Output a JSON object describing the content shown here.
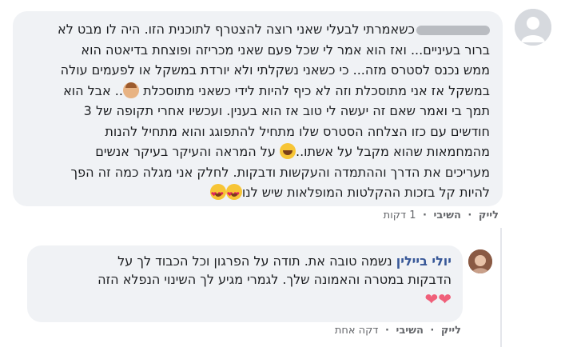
{
  "comment": {
    "lines": [
      "כשאמרתי לבעלי שאני רוצה להצטרף לתוכנית הזו. היה לו מבט לא",
      "ברור בעיניים... ואז הוא אמר לי שכל פעם שאני מכריזה ופוצחת בדיאטה הוא",
      "ממש נכנס לסטרס מזה... כי כשאני נשקלתי ולא יורדת במשקל או לפעמים עולה",
      "במשקל אז אני מתוסכלת וזה לא כיף להיות לידי כשאני מתוסכלת",
      ".. אבל הוא",
      "תמך בי ואמר שאם זה יעשה לי טוב אז הוא בענין. ועכשיו אחרי תקופה של 3",
      "חודשים עם כזו הצלחה הסטרס שלו מתחיל להתפוגג והוא מתחיל להנות",
      "מהמחמאות שהוא מקבל על אשתו..",
      " על המראה והעיקר בעיקר אנשים",
      "מעריכים את הדרך וההתמדה והעקשות ודבקות. לחלק אני מגלה כמה זה הפך",
      "להיות קל בזכות ההקלטות המופלאות שיש לנו"
    ],
    "emoji_face": "face-emoji",
    "emoji_laugh": "laughing-emoji",
    "emoji_love": "heart-eyes-emoji",
    "actions": {
      "like": "לייק",
      "sep1": "·",
      "reply": "השיבי",
      "sep2": "·",
      "time": "1 דקות"
    }
  },
  "reply": {
    "author": "יולי ביילין",
    "lines": [
      " נשמה טובה את. תודה על הפרגון וכל הכבוד לך על",
      "הדבקות במטרה והאמונה שלך. לגמרי מגיע לך השינוי הנפלא הזה"
    ],
    "hearts": "❤❤",
    "actions": {
      "like": "לייק",
      "sep1": "·",
      "reply": "השיבי",
      "sep2": "·",
      "time": "דקה אחת"
    }
  },
  "colors": {
    "bubble": "#f0f2f5",
    "link": "#385898",
    "meta": "#65676b",
    "heart": "#f0607a"
  }
}
